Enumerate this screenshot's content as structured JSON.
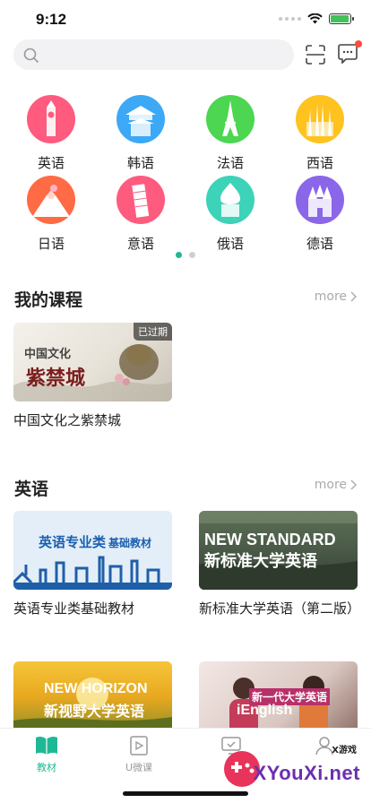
{
  "status": {
    "time": "9:12"
  },
  "search": {
    "placeholder": ""
  },
  "languages": [
    {
      "label": "英语",
      "color": "#ff5b7f"
    },
    {
      "label": "韩语",
      "color": "#3da8f5"
    },
    {
      "label": "法语",
      "color": "#4cd651"
    },
    {
      "label": "西语",
      "color": "#ffc21f"
    },
    {
      "label": "日语",
      "color": "#ff6b45"
    },
    {
      "label": "意语",
      "color": "#ff5b7f"
    },
    {
      "label": "俄语",
      "color": "#3cd3b8"
    },
    {
      "label": "德语",
      "color": "#8a66e8"
    }
  ],
  "my_courses": {
    "title": "我的课程",
    "more": "more",
    "items": [
      {
        "name": "中国文化之紫禁城",
        "tag": "已过期",
        "cover_text": "中国文化",
        "cover_text2": "紫禁城"
      }
    ]
  },
  "english": {
    "title": "英语",
    "more": "more",
    "items": [
      {
        "name": "英语专业类基础教材",
        "cover_text": "英语专业类",
        "cover_text2": "基础教材"
      },
      {
        "name": "新标准大学英语（第二版）",
        "cover_text": "NEW STANDARD",
        "cover_text2": "新标准大学英语"
      },
      {
        "name": "",
        "cover_text": "NEW HORIZON",
        "cover_text2": "新视野大学英语"
      },
      {
        "name": "",
        "cover_text": "新一代大学英语",
        "cover_text2": "iEnglish"
      }
    ]
  },
  "tabbar": {
    "items": [
      {
        "label": "教材",
        "active": true
      },
      {
        "label": "U微课",
        "active": false
      },
      {
        "label": "",
        "active": false
      },
      {
        "label": "",
        "active": false
      }
    ]
  },
  "watermark": {
    "brand": "XYouXi.net",
    "sub": "X游戏"
  },
  "colors": {
    "accent": "#1fb894",
    "text": "#222222",
    "muted": "#aaaaaa"
  }
}
